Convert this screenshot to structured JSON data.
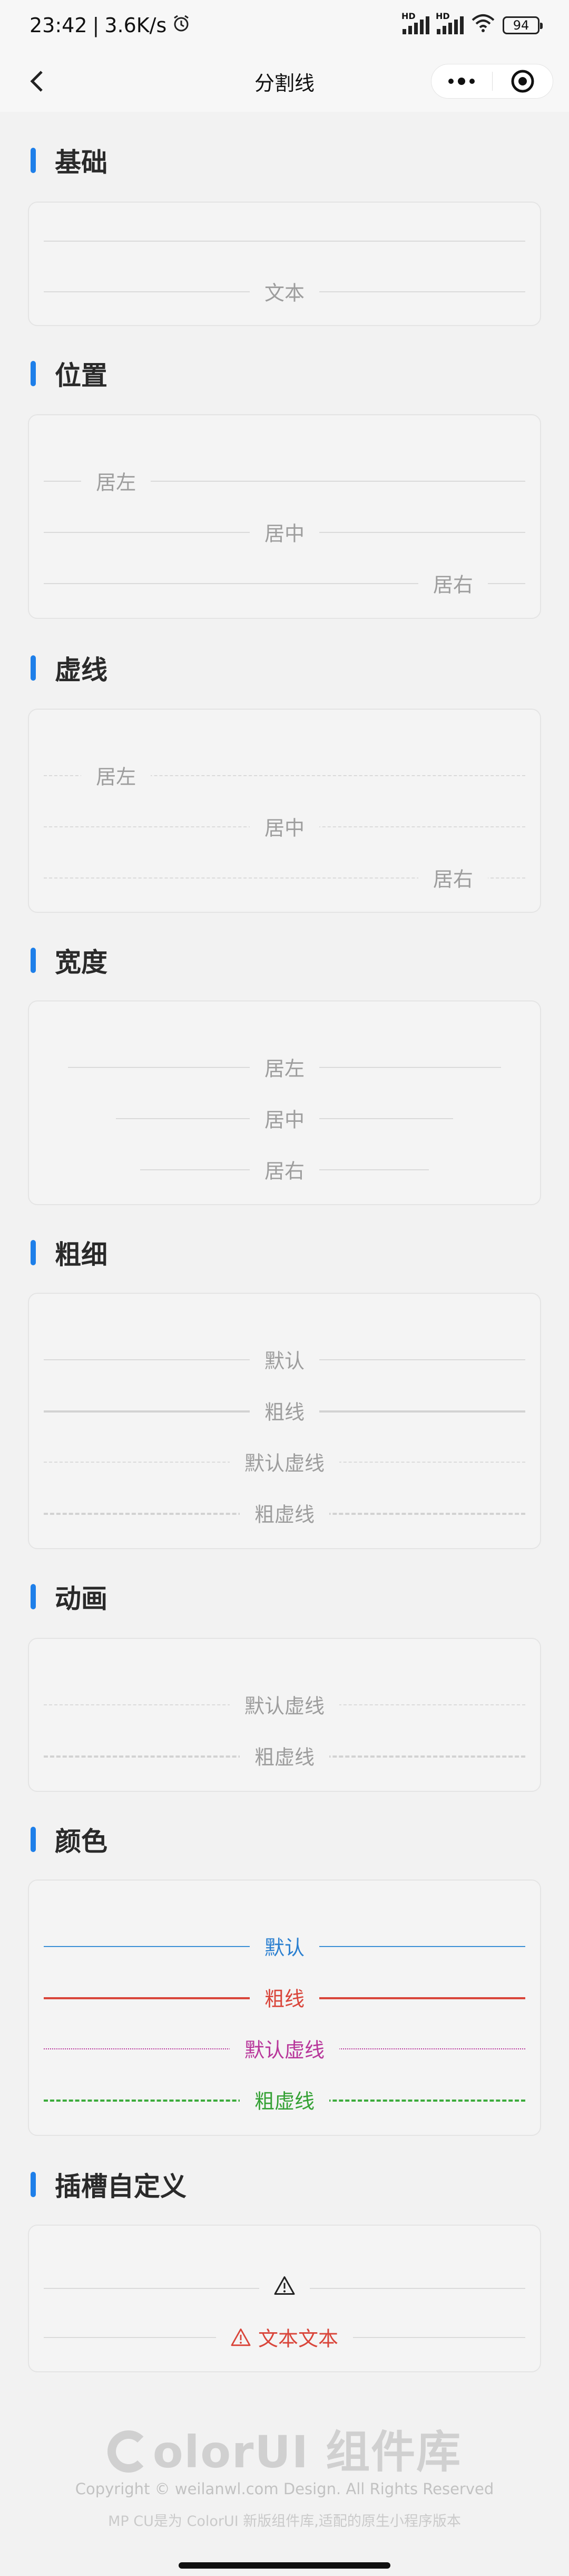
{
  "status_bar": {
    "time": "23:42",
    "separator": "|",
    "network_speed": "3.6K/s",
    "hd1": "HD",
    "hd2": "HD",
    "battery": "94"
  },
  "nav": {
    "title": "分割线"
  },
  "sections": {
    "basic": {
      "title": "基础",
      "row2": "文本"
    },
    "position": {
      "title": "位置",
      "left": "居左",
      "center": "居中",
      "right": "居右"
    },
    "dashed": {
      "title": "虚线",
      "left": "居左",
      "center": "居中",
      "right": "居右"
    },
    "width": {
      "title": "宽度",
      "r1": "居左",
      "r2": "居中",
      "r3": "居右"
    },
    "thickness": {
      "title": "粗细",
      "r1": "默认",
      "r2": "粗线",
      "r3": "默认虚线",
      "r4": "粗虚线"
    },
    "animation": {
      "title": "动画",
      "r1": "默认虚线",
      "r2": "粗虚线"
    },
    "color": {
      "title": "颜色",
      "r1": "默认",
      "r2": "粗线",
      "r3": "默认虚线",
      "r4": "粗虚线"
    },
    "slot": {
      "title": "插槽自定义",
      "r2": "文本文本"
    }
  },
  "colors": {
    "accent": "#1e7fe9",
    "blue": "#3b8fd6",
    "red": "#d9453a",
    "purple": "#b8379b",
    "green": "#3bab3b"
  },
  "footer": {
    "logo": "olorUI 组件库",
    "copyright": "Copyright © weilanwl.com Design. All Rights Reserved",
    "description": "MP CU是为 ColorUI 新版组件库,适配的原生小程序版本"
  }
}
